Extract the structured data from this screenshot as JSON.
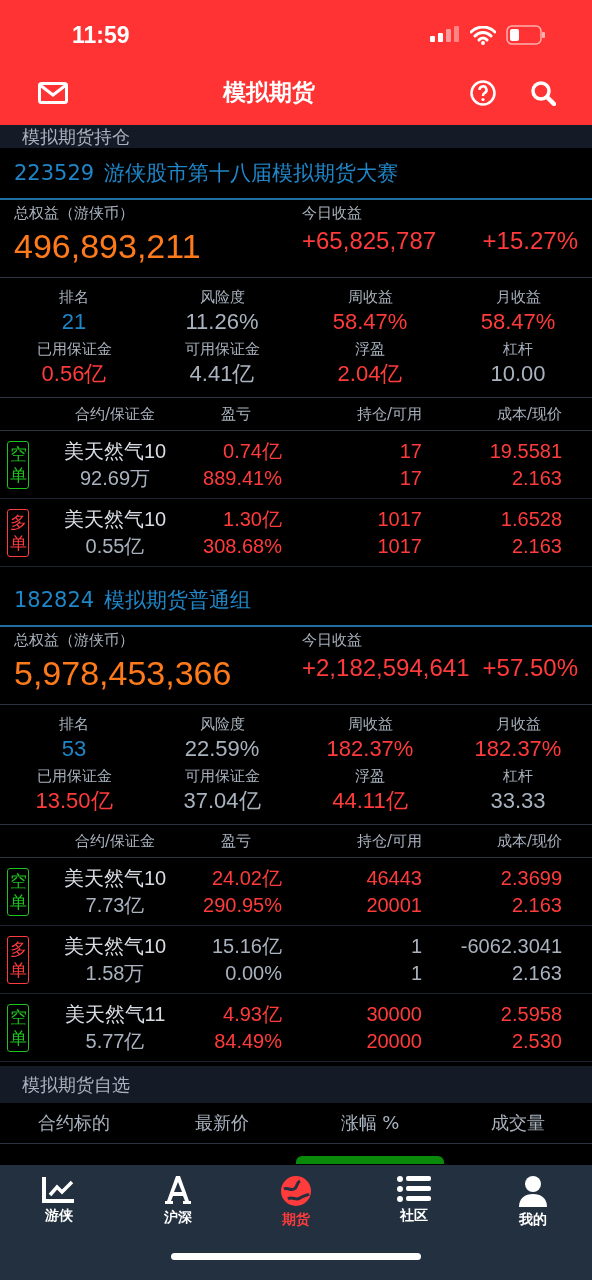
{
  "status_bar": {
    "time": "11:59"
  },
  "nav": {
    "title": "模拟期货"
  },
  "section_title": "模拟期货持仓",
  "accounts": [
    {
      "id": "223529",
      "name": "游侠股市第十八届模拟期货大赛",
      "equity_label": "总权益（游侠币）",
      "equity": "496,893,211",
      "today_label": "今日收益",
      "today_gain": "+65,825,787",
      "today_pct": "+15.27%",
      "stats": [
        {
          "label": "排名",
          "value": "21",
          "color": "#1f86c8"
        },
        {
          "label": "风险度",
          "value": "11.26%",
          "color": "#a9b3bf"
        },
        {
          "label": "周收益",
          "value": "58.47%",
          "color": "#ff3b3b"
        },
        {
          "label": "月收益",
          "value": "58.47%",
          "color": "#ff3b3b"
        },
        {
          "label": "已用保证金",
          "value": "0.56亿",
          "color": "#ff3b3b"
        },
        {
          "label": "可用保证金",
          "value": "4.41亿",
          "color": "#a9b3bf"
        },
        {
          "label": "浮盈",
          "value": "2.04亿",
          "color": "#ff3b3b"
        },
        {
          "label": "杠杆",
          "value": "10.00",
          "color": "#a9b3bf"
        }
      ],
      "columns": [
        "合约/保证金",
        "盈亏",
        "持仓/可用",
        "成本/现价"
      ],
      "positions": [
        {
          "kind": "short",
          "side": "空单",
          "contract": "美天然气10",
          "margin": "92.69万",
          "pnl": "0.74亿",
          "pnl_pct": "889.41%",
          "held": "17",
          "available": "17",
          "cost": "19.5581",
          "price": "2.163",
          "color": "#ff3b3b"
        },
        {
          "kind": "long",
          "side": "多单",
          "contract": "美天然气10",
          "margin": "0.55亿",
          "pnl": "1.30亿",
          "pnl_pct": "308.68%",
          "held": "1017",
          "available": "1017",
          "cost": "1.6528",
          "price": "2.163",
          "color": "#ff3b3b"
        }
      ]
    },
    {
      "id": "182824",
      "name": "模拟期货普通组",
      "equity_label": "总权益（游侠币）",
      "equity": "5,978,453,366",
      "today_label": "今日收益",
      "today_gain": "+2,182,594,641",
      "today_pct": "+57.50%",
      "stats": [
        {
          "label": "排名",
          "value": "53",
          "color": "#1f86c8"
        },
        {
          "label": "风险度",
          "value": "22.59%",
          "color": "#a9b3bf"
        },
        {
          "label": "周收益",
          "value": "182.37%",
          "color": "#ff3b3b"
        },
        {
          "label": "月收益",
          "value": "182.37%",
          "color": "#ff3b3b"
        },
        {
          "label": "已用保证金",
          "value": "13.50亿",
          "color": "#ff3b3b"
        },
        {
          "label": "可用保证金",
          "value": "37.04亿",
          "color": "#a9b3bf"
        },
        {
          "label": "浮盈",
          "value": "44.11亿",
          "color": "#ff3b3b"
        },
        {
          "label": "杠杆",
          "value": "33.33",
          "color": "#a9b3bf"
        }
      ],
      "columns": [
        "合约/保证金",
        "盈亏",
        "持仓/可用",
        "成本/现价"
      ],
      "positions": [
        {
          "kind": "short",
          "side": "空单",
          "contract": "美天然气10",
          "margin": "7.73亿",
          "pnl": "24.02亿",
          "pnl_pct": "290.95%",
          "held": "46443",
          "available": "20001",
          "cost": "2.3699",
          "price": "2.163",
          "color": "#ff3b3b"
        },
        {
          "kind": "long",
          "side": "多单",
          "contract": "美天然气10",
          "margin": "1.58万",
          "pnl": "15.16亿",
          "pnl_pct": "0.00%",
          "held": "1",
          "available": "1",
          "cost": "-6062.3041",
          "price": "2.163",
          "color": "#a9b3bf"
        },
        {
          "kind": "short",
          "side": "空单",
          "contract": "美天然气11",
          "margin": "5.77亿",
          "pnl": "4.93亿",
          "pnl_pct": "84.49%",
          "held": "30000",
          "available": "20000",
          "cost": "2.5958",
          "price": "2.530",
          "color": "#ff3b3b"
        }
      ]
    }
  ],
  "watchlist": {
    "title": "模拟期货自选",
    "columns": [
      "合约标的",
      "最新价",
      "涨幅 %",
      "成交量"
    ]
  },
  "tabs": [
    {
      "label": "游侠",
      "selected": false
    },
    {
      "label": "沪深",
      "selected": false
    },
    {
      "label": "期货",
      "selected": true
    },
    {
      "label": "社区",
      "selected": false
    },
    {
      "label": "我的",
      "selected": false
    }
  ]
}
